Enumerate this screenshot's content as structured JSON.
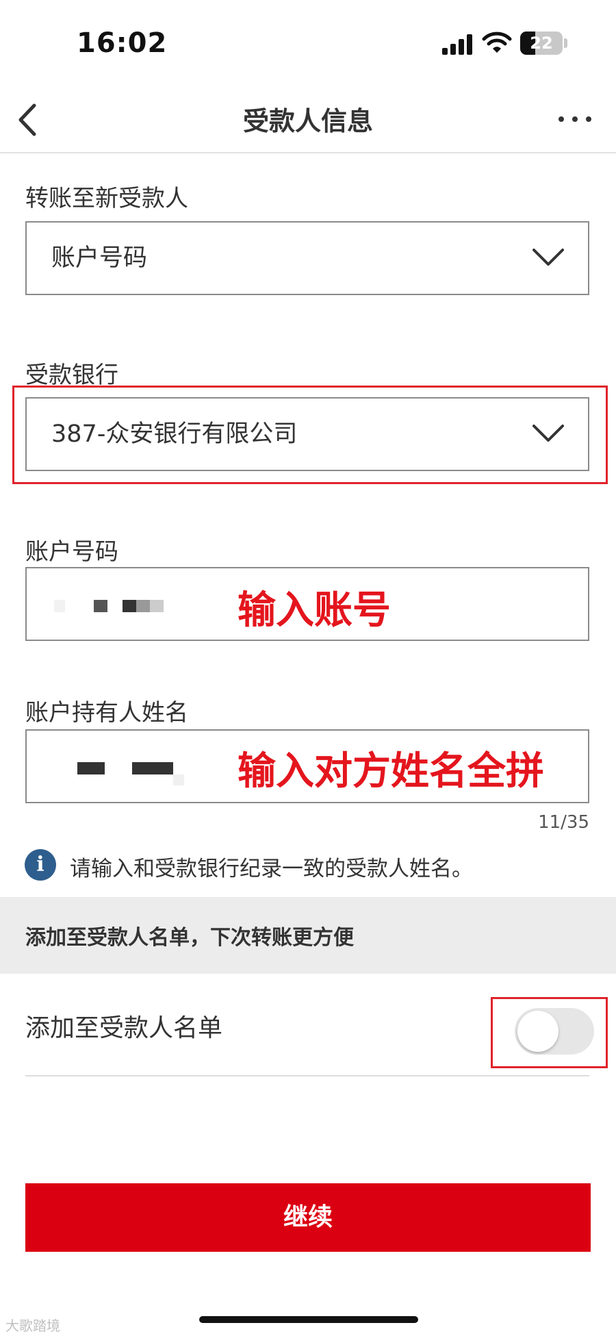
{
  "status_bar": {
    "time": "16:02",
    "battery": "22"
  },
  "header": {
    "title": "受款人信息"
  },
  "form": {
    "transfer_label": "转账至新受款人",
    "transfer_select_value": "账户号码",
    "bank_label": "受款银行",
    "bank_select_value": "387-众安银行有限公司",
    "account_label": "账户号码",
    "account_annotation": "输入账号",
    "holder_label": "账户持有人姓名",
    "holder_annotation": "输入对方姓名全拼",
    "holder_counter": "11/35",
    "info_icon_glyph": "i",
    "info_text": "请输入和受款银行纪录一致的受款人姓名。"
  },
  "favorites": {
    "section_title": "添加至受款人名单，下次转账更方便",
    "toggle_label": "添加至受款人名单",
    "toggle_on": false
  },
  "actions": {
    "continue_label": "继续"
  },
  "watermark": "大歌踏境",
  "colors": {
    "accent_red": "#db0011",
    "annotation_red": "#e0232b",
    "info_blue": "#2e5e8e"
  },
  "icons": [
    "back-icon",
    "more-icon",
    "chevron-down-icon",
    "info-icon",
    "signal-icon",
    "wifi-icon",
    "battery-icon"
  ]
}
